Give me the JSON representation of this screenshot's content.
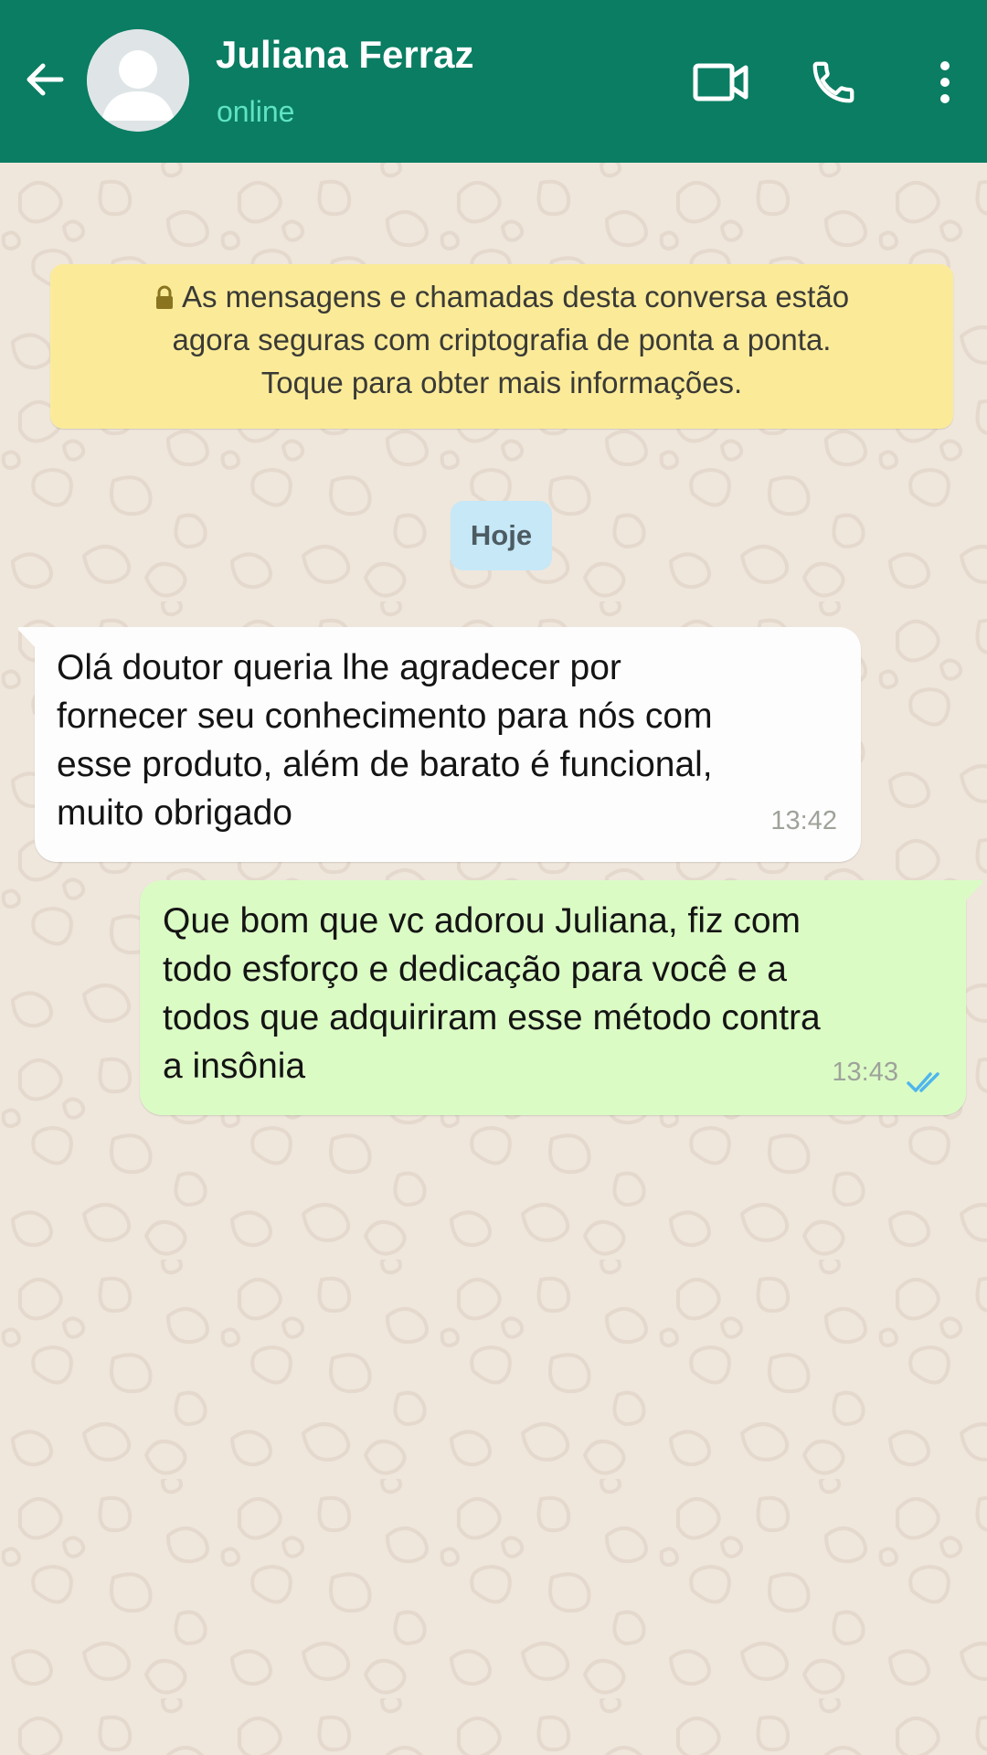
{
  "header": {
    "contact_name": "Juliana Ferraz",
    "status": "online",
    "background_color": "#0a7d62",
    "icons": [
      "arrow-left-icon",
      "avatar-placeholder-icon",
      "video-call-icon",
      "phone-icon",
      "more-vertical-icon"
    ]
  },
  "chat": {
    "encryption_notice": {
      "line1": "As mensagens e chamadas desta conversa estão",
      "line2": "agora seguras com criptografia de ponta a ponta.",
      "line3": "Toque para obter mais informações.",
      "icon": "lock-icon"
    },
    "date_chip": "Hoje",
    "messages": [
      {
        "direction": "incoming",
        "lines": [
          "Olá doutor queria lhe agradecer por",
          "fornecer seu conhecimento para nós com",
          "esse produto, além de barato é funcional,",
          "muito obrigado"
        ],
        "time": "13:42"
      },
      {
        "direction": "outgoing",
        "lines": [
          "Que bom que vc adorou Juliana, fiz com",
          "todo esforço e dedicação para você e a",
          "todos que adquiriram esse método contra",
          "a insônia"
        ],
        "time": "13:43",
        "status_icon": "double-check-read-icon"
      }
    ]
  },
  "colors": {
    "chat_background": "#efe6dc",
    "incoming_bubble": "#fdfdfd",
    "outgoing_bubble": "#dbfbc5",
    "notice_background": "#fbeb99",
    "date_chip_background": "#c6e8f7",
    "read_ticks": "#4fb6ec"
  }
}
